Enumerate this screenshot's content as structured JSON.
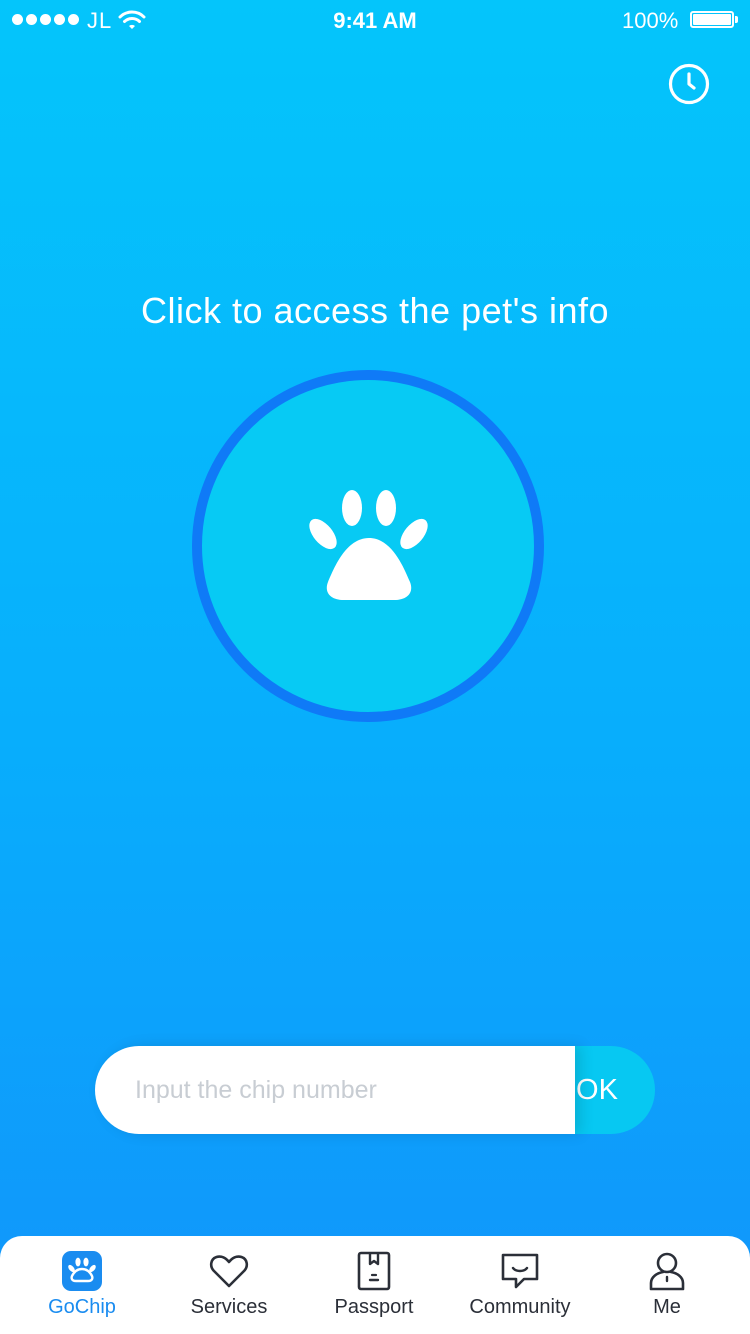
{
  "status_bar": {
    "carrier": "JL",
    "time": "9:41 AM",
    "battery": "100%"
  },
  "header": {
    "history_icon": "clock-icon"
  },
  "main": {
    "prompt": "Click to access the pet's info",
    "scan_icon": "paw-icon"
  },
  "chip_form": {
    "placeholder": "Input the chip number",
    "value": "",
    "ok_label": "OK"
  },
  "tabs": [
    {
      "label": "GoChip",
      "icon": "paw-icon",
      "active": true
    },
    {
      "label": "Services",
      "icon": "heart-icon",
      "active": false
    },
    {
      "label": "Passport",
      "icon": "passport-icon",
      "active": false
    },
    {
      "label": "Community",
      "icon": "chat-bubble-icon",
      "active": false
    },
    {
      "label": "Me",
      "icon": "person-icon",
      "active": false
    }
  ],
  "colors": {
    "accent": "#1a8cf0",
    "background_top": "#04c5fb",
    "background_bottom": "#1195fb",
    "circle_fill": "#07caf4",
    "circle_ring": "#0f7af7",
    "ok_button": "#07c8f2"
  }
}
